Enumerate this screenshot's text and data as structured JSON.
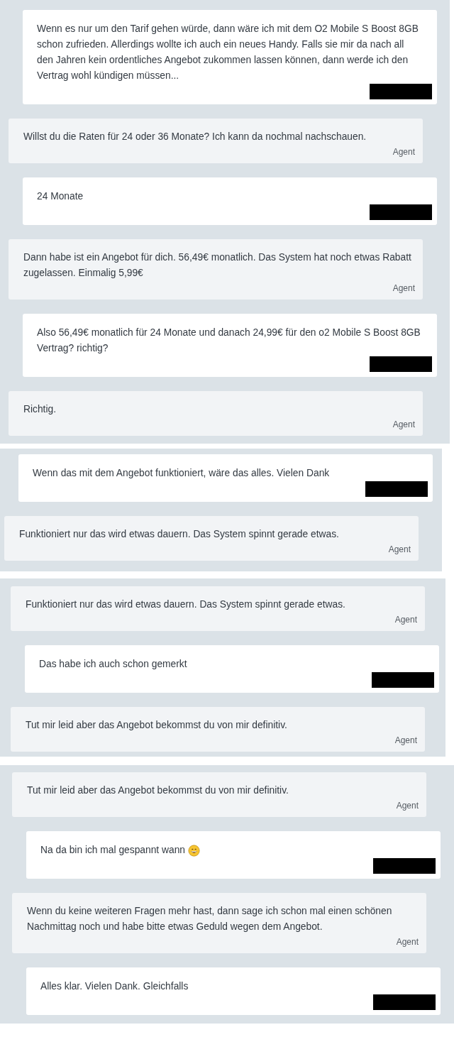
{
  "panels": [
    {
      "messages": [
        {
          "kind": "user",
          "text": "Wenn es nur um den Tarif gehen würde, dann wäre ich mit dem O2 Mobile S Boost 8GB schon zufrieden. Allerdings wollte ich auch ein neues Handy. Falls sie mir da nach all den Jahren kein ordentliches Angebot zukommen lassen können, dann werde ich den Vertrag wohl kündigen müssen..."
        },
        {
          "kind": "agent",
          "text": "Willst du die Raten für 24 oder 36 Monate? Ich kann da nochmal nachschauen.",
          "sender": "Agent"
        },
        {
          "kind": "user",
          "text": "24 Monate"
        },
        {
          "kind": "agent",
          "text": "Dann habe ist ein Angebot für dich. 56,49€ monatlich. Das System hat noch etwas Rabatt zugelassen. Einmalig 5,99€",
          "sender": "Agent"
        },
        {
          "kind": "user",
          "text": "Also 56,49€ monatlich für 24 Monate und danach 24,99€ für den o2 Mobile S Boost 8GB Vertrag? richtig?"
        },
        {
          "kind": "agent",
          "text": "Richtig.",
          "sender": "Agent"
        }
      ]
    },
    {
      "messages": [
        {
          "kind": "user",
          "text": "Wenn das mit dem Angebot funktioniert, wäre das alles. Vielen Dank"
        },
        {
          "kind": "agent",
          "text": "Funktioniert nur das wird etwas dauern. Das System spinnt gerade etwas.",
          "sender": "Agent"
        }
      ]
    },
    {
      "messages": [
        {
          "kind": "agent",
          "text": "Funktioniert nur das wird etwas dauern. Das System spinnt gerade etwas.",
          "sender": "Agent"
        },
        {
          "kind": "user",
          "text": "Das habe ich auch schon gemerkt"
        },
        {
          "kind": "agent",
          "text": "Tut mir leid aber das Angebot bekommst du von mir definitiv.",
          "sender": "Agent"
        }
      ]
    },
    {
      "messages": [
        {
          "kind": "agent",
          "text": "Tut mir leid aber das Angebot bekommst du von mir definitiv.",
          "sender": "Agent"
        },
        {
          "kind": "user",
          "text": "Na da bin ich mal gespannt wann",
          "emoji": true
        },
        {
          "kind": "agent",
          "text": "Wenn du keine weiteren Fragen mehr hast, dann sage ich schon mal einen schönen Nachmittag noch und habe bitte etwas Geduld wegen dem Angebot.",
          "sender": "Agent"
        },
        {
          "kind": "user",
          "text": "Alles klar. Vielen Dank. Gleichfalls"
        }
      ]
    }
  ]
}
